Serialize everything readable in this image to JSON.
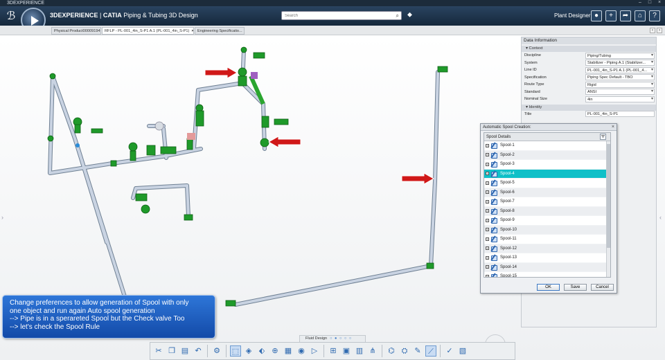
{
  "window": {
    "title": "3DEXPERIENCE"
  },
  "app": {
    "brand": "3DEXPERIENCE",
    "separator": " | ",
    "product": "CATIA",
    "app_name": "Piping & Tubing 3D Design",
    "search_placeholder": "Search",
    "role": "Plant Designer"
  },
  "tabs": [
    {
      "label": "Physical Product00009194"
    },
    {
      "label": "RFLP - PL-001_4in_S-P1 A.1 (PL-001_4in_S-P1)"
    },
    {
      "label": "Engineering Specificatio..."
    }
  ],
  "data_panel": {
    "title": "Data Information",
    "context_label": "Context",
    "rows": [
      {
        "key": "Discipline",
        "value": "Piping/Tubing"
      },
      {
        "key": "System",
        "value": "Stabilizer - Piping A.1 (Stabilizer..."
      },
      {
        "key": "Line ID",
        "value": "PL-001_4in_S-P1 A.1 (PL-001_4..."
      },
      {
        "key": "Specification",
        "value": "Piping Spec Default - TBO"
      },
      {
        "key": "Route Type",
        "value": "Rigid"
      },
      {
        "key": "Standard",
        "value": "ANSI"
      },
      {
        "key": "Nominal Size",
        "value": "4in"
      }
    ],
    "identity_label": "Identity",
    "title_key": "Title",
    "title_value": "PL-001_4in_S-P1"
  },
  "spool_dialog": {
    "title": "Automatic Spool Creation:",
    "header": "Spool Details",
    "items": [
      "Spool-1",
      "Spool-2",
      "Spool-3",
      "Spool-4",
      "Spool-5",
      "Spool-6",
      "Spool-7",
      "Spool-8",
      "Spool-9",
      "Spool-10",
      "Spool-11",
      "Spool-12",
      "Spool-13",
      "Spool-14",
      "Spool-15"
    ],
    "selected_index": 3,
    "ok_label": "OK",
    "save_label": "Save",
    "cancel_label": "Cancel"
  },
  "note": {
    "lines": [
      "Change preferences to allow generation of Spool with only",
      "one object and run again Auto spool generation",
      "--> Pipe is in a sperareted Spool but the Check valve Too",
      "--> let's check the Spool Rule"
    ]
  },
  "action_bar": {
    "section_label": "Fluid Design",
    "page_dots": "○ ● ○ ○ ○"
  },
  "colors": {
    "pipe": "#b8c4d6",
    "valve_green": "#1f9a2a",
    "arrow_red": "#d01818",
    "selection": "#10c0c8"
  }
}
